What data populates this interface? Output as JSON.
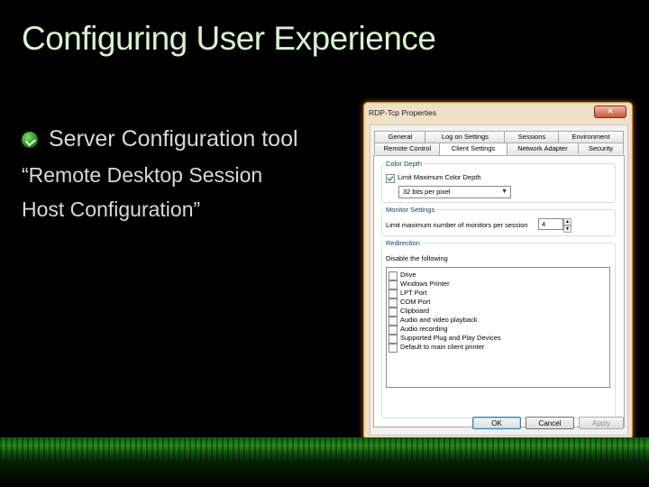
{
  "slide": {
    "title": "Configuring User Experience",
    "bullet": "Server Configuration tool",
    "quote_line1": "“Remote Desktop Session",
    "quote_line2": "Host  Configuration”"
  },
  "dialog": {
    "title": "RDP-Tcp Properties",
    "close_glyph": "✕",
    "tabs_row1": [
      "General",
      "Log on Settings",
      "Sessions",
      "Environment"
    ],
    "tabs_row2": [
      "Remote Control",
      "Client Settings",
      "Network Adapter",
      "Security"
    ],
    "active_tab": "Client Settings",
    "color_depth": {
      "group_label": "Color Depth",
      "checkbox_label": "Limit Maximum Color Depth",
      "checked": true,
      "selected": "32 bits per pixel"
    },
    "monitor": {
      "group_label": "Monitor Settings",
      "label": "Limit maximum number of monitors per session",
      "value": "4"
    },
    "redirection": {
      "group_label": "Redirection",
      "disable_label": "Disable the following",
      "items": [
        "Drive",
        "Windows Printer",
        "LPT Port",
        "COM Port",
        "Clipboard",
        "Audio and video playback",
        "Audio recording",
        "Supported Plug and Play Devices",
        "Default to main client printer"
      ]
    },
    "buttons": {
      "ok": "OK",
      "cancel": "Cancel",
      "apply": "Apply"
    }
  },
  "colors": {
    "title_green": "#d8f3d0",
    "dialog_border": "#c98a2a",
    "band_green": "#2a8a1f"
  }
}
